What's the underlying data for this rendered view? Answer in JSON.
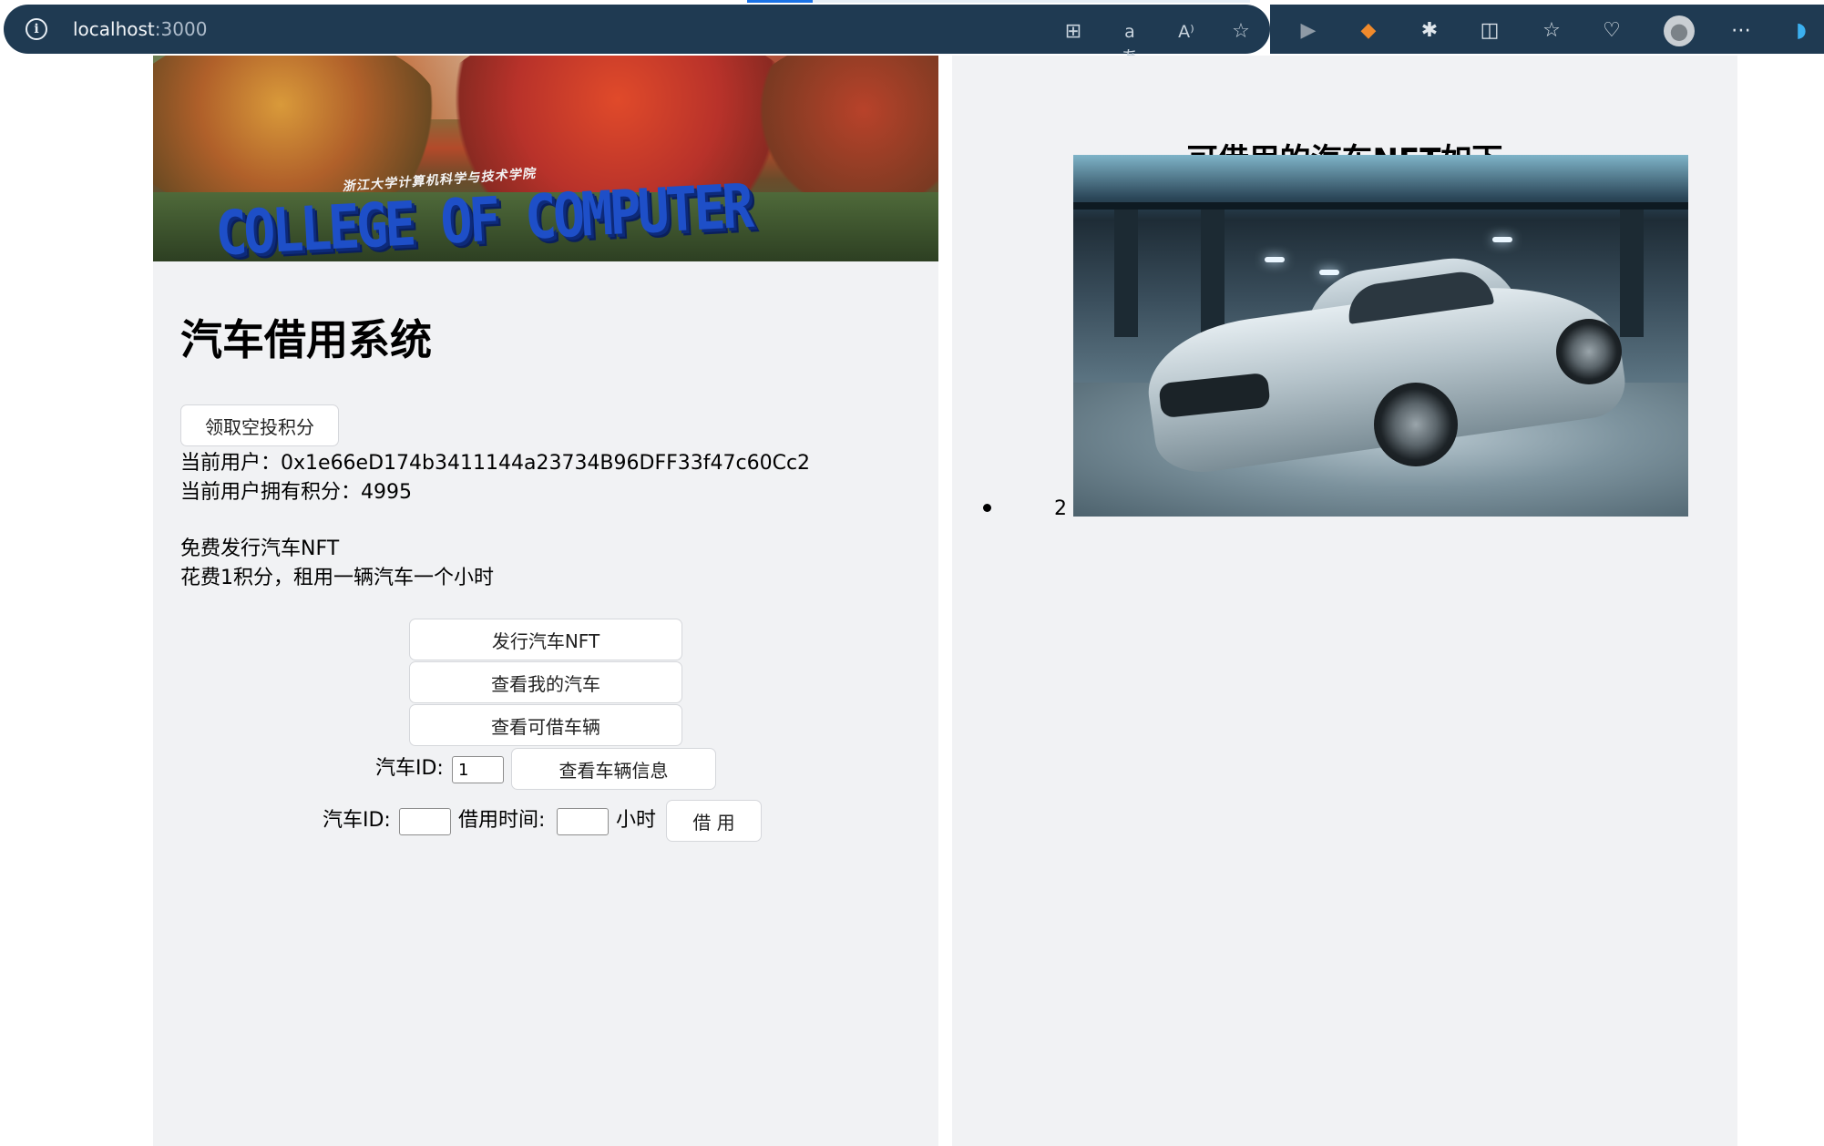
{
  "browser": {
    "url_host": "localhost",
    "url_port": ":3000",
    "icons": [
      "apps-icon",
      "translate-icon",
      "read-aloud-icon",
      "favorite-star-icon",
      "play-icon",
      "metamask-fox-icon",
      "extensions-icon",
      "split-screen-icon",
      "favorites-icon",
      "browser-essentials-icon",
      "profile-avatar-icon",
      "more-menu-icon",
      "copilot-icon"
    ]
  },
  "left": {
    "title": "汽车借用系统",
    "airdrop_button": "领取空投积分",
    "current_user_label": "当前用户：",
    "current_user_address": "0x1e66eD174b3411144a23734B96DFF33f47c60Cc2",
    "points_label": "当前用户拥有积分：",
    "points_value": "4995",
    "note_free": "免费发行汽车NFT",
    "note_cost": "花费1积分，租用一辆汽车一个小时",
    "mint_button": "发行汽车NFT",
    "my_cars_button": "查看我的汽车",
    "available_button": "查看可借车辆",
    "car_id_label": "汽车ID:",
    "car_id_value": "1",
    "car_info_button": "查看车辆信息",
    "borrow_car_id_label": "汽车ID:",
    "borrow_car_id_value": "",
    "borrow_time_label": "借用时间:",
    "borrow_time_value": "",
    "hours_label": "小时",
    "borrow_button": "借 用"
  },
  "right": {
    "title": "可借用的汽车NFT如下",
    "cars": [
      {
        "id": "2"
      }
    ]
  }
}
